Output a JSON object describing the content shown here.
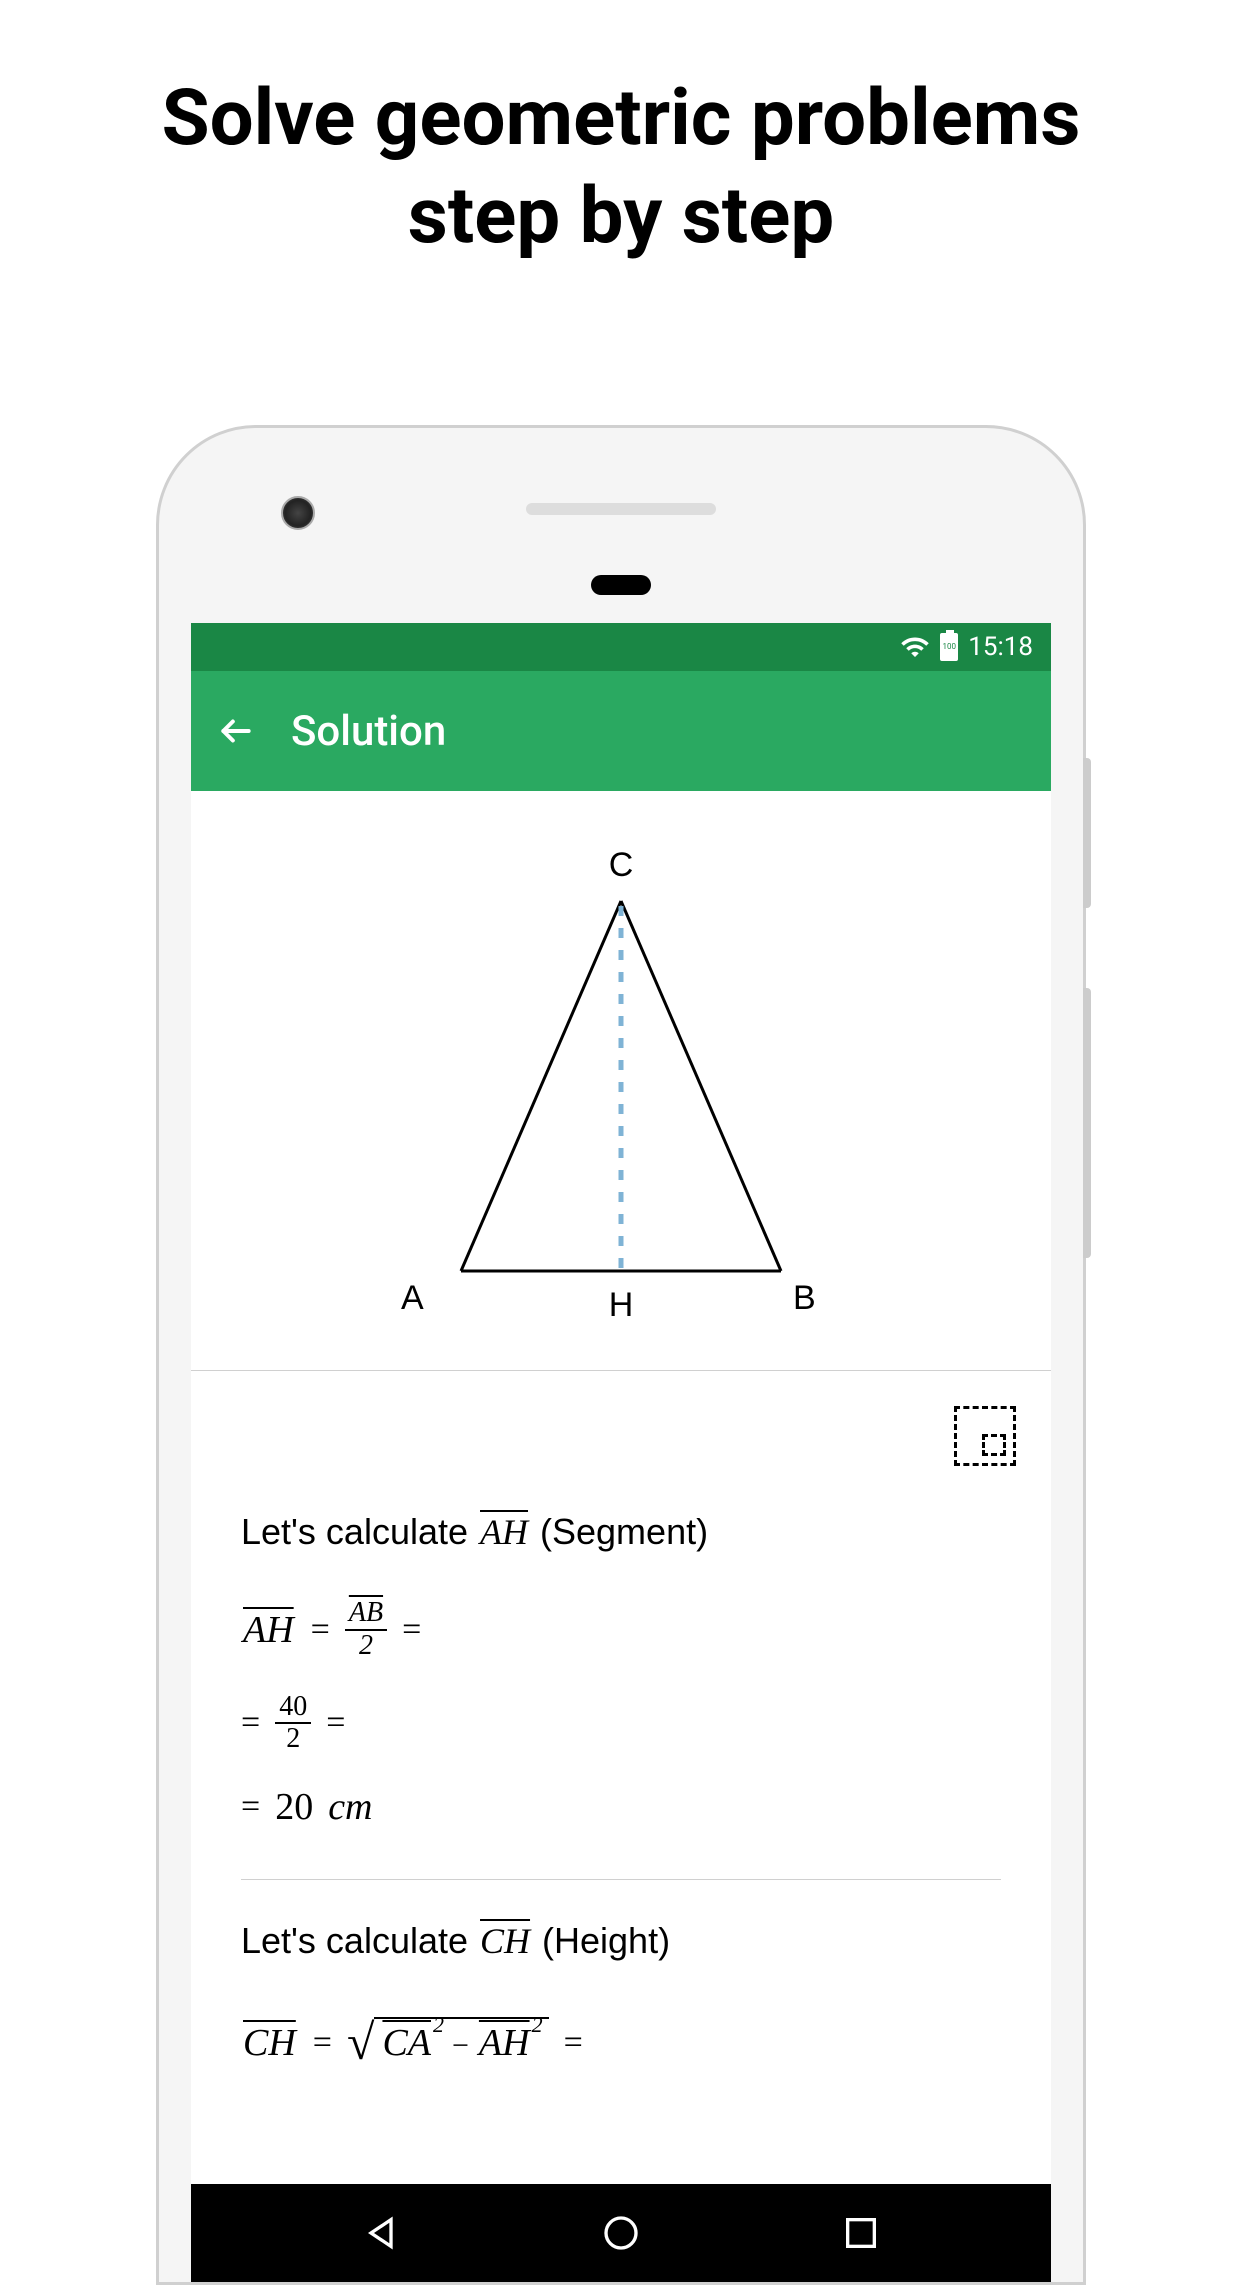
{
  "promo": {
    "line1": "Solve geometric problems",
    "line2": "step by step"
  },
  "status": {
    "time": "15:18",
    "battery_text": "100"
  },
  "appbar": {
    "title": "Solution"
  },
  "diagram": {
    "labels": {
      "top": "C",
      "left": "A",
      "right": "B",
      "foot": "H"
    }
  },
  "solution": {
    "step1": {
      "intro_prefix": "Let's calculate ",
      "segment": "AH",
      "intro_suffix": " (Segment)",
      "lhs": "AH",
      "frac1_num": "AB",
      "frac1_den": "2",
      "frac2_num": "40",
      "frac2_den": "2",
      "result_val": "20",
      "result_unit": "cm"
    },
    "step2": {
      "intro_prefix": "Let's calculate ",
      "segment": "CH",
      "intro_suffix": " (Height)",
      "lhs": "CH",
      "t1": "CA",
      "t2": "AH",
      "exp": "2"
    }
  }
}
